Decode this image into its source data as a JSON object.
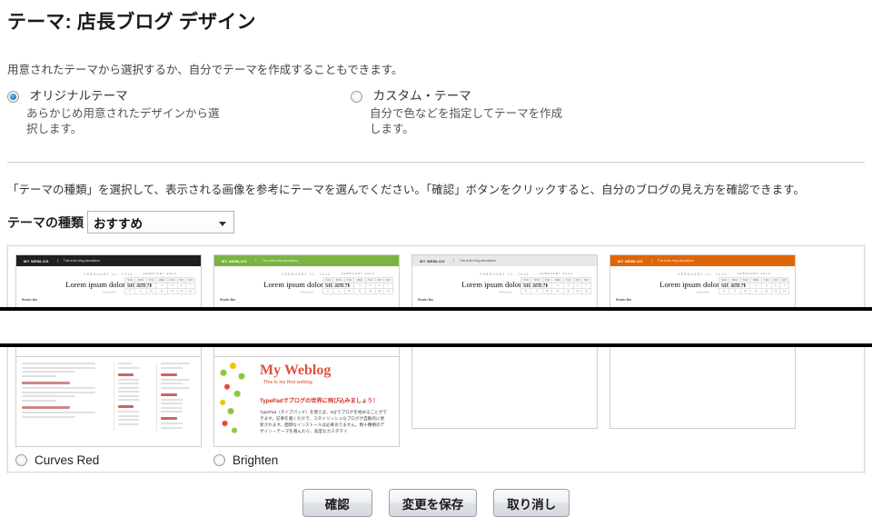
{
  "page": {
    "title": "テーマ: 店長ブログ デザイン",
    "intro": "用意されたテーマから選択するか、自分でテーマを作成することもできます。",
    "instruction": "「テーマの種類」を選択して、表示される画像を参考にテーマを選んでください。「確認」ボタンをクリックすると、自分のブログの見え方を確認できます。"
  },
  "theme_mode": {
    "options": [
      {
        "label": "オリジナルテーマ",
        "description": "あらかじめ用意されたデザインから選択します。",
        "selected": true
      },
      {
        "label": "カスタム・テーマ",
        "description": "自分で色などを指定してテーマを作成します。",
        "selected": false
      }
    ]
  },
  "theme_kind": {
    "label": "テーマの種類",
    "value": "おすすめ",
    "arrow_icon": "chevron-down-icon"
  },
  "gallery": {
    "themes": [
      {
        "name": "",
        "selected": false,
        "accent": "#1f1f1f",
        "logo": "MY WEBLOG",
        "tagline": "This is the blog description",
        "date": "FEBRUARY 11, 2010",
        "headline": "Lorem ipsum dolor sit amet",
        "byline": "Reader Bar",
        "calendar_title": "FEBRUARY 2010"
      },
      {
        "name": "",
        "selected": false,
        "accent": "#7cb342",
        "logo": "MY WEBLOG",
        "tagline": "This is the blog description",
        "date": "FEBRUARY 11, 2010",
        "headline": "Lorem ipsum dolor sit amet",
        "byline": "Reader Bar",
        "calendar_title": "FEBRUARY 2010"
      },
      {
        "name": "",
        "selected": false,
        "accent": "#e8e8e8",
        "logo": "MY WEBLOG",
        "tagline": "This is the blog description",
        "date": "FEBRUARY 11, 2010",
        "headline": "Lorem ipsum dolor sit amet",
        "byline": "Reader Bar",
        "calendar_title": "FEBRUARY 2010"
      },
      {
        "name": "",
        "selected": false,
        "accent": "#df6608",
        "logo": "MY WEBLOG",
        "tagline": "This is the blog description",
        "date": "FEBRUARY 11, 2010",
        "headline": "Lorem ipsum dolor sit amet",
        "byline": "Reader Bar",
        "calendar_title": "FEBRUARY 2010"
      }
    ],
    "themes_row2": [
      {
        "name": "Curves Red",
        "selected": false,
        "accent": "#c0392b",
        "post_titles": [
          "Dolor Sit Amet",
          "Consectetur Adipisicing"
        ],
        "sidebar_headings": [
          "Categories",
          "Archives",
          "Weph.com",
          "About"
        ]
      },
      {
        "name": "Brighten",
        "selected": false,
        "accent": "#e0513a",
        "blog_title": "My Weblog",
        "blog_subtitle": "This is my first weblog",
        "promo_heading": "TypePadでブログの世界に飛び込みましょう！",
        "promo_body": "TypePad（タイプパッド）を使えば、5分でブログを始めることができます。記事を書くだけで、スタイリッシュなブログが自動的に更新されます。面倒なインストールは必要ありません。数十種類のデザイン・テーマを選んだら、高度なカスタマイ"
      }
    ]
  },
  "calendar": {
    "weekday_headers": [
      "SUN",
      "MON",
      "TUE",
      "WED",
      "THU",
      "FRI",
      "SAT"
    ],
    "week1": [
      "1",
      "2",
      "3",
      "4",
      "5",
      "6",
      "7"
    ],
    "week2": [
      "8",
      "9",
      "10",
      "11",
      "12",
      "13",
      "14"
    ],
    "highlight_day": "3"
  },
  "footer": {
    "buttons": [
      {
        "label": "確認",
        "name": "confirm-button"
      },
      {
        "label": "変更を保存",
        "name": "save-changes-button"
      },
      {
        "label": "取り消し",
        "name": "cancel-button"
      }
    ]
  }
}
